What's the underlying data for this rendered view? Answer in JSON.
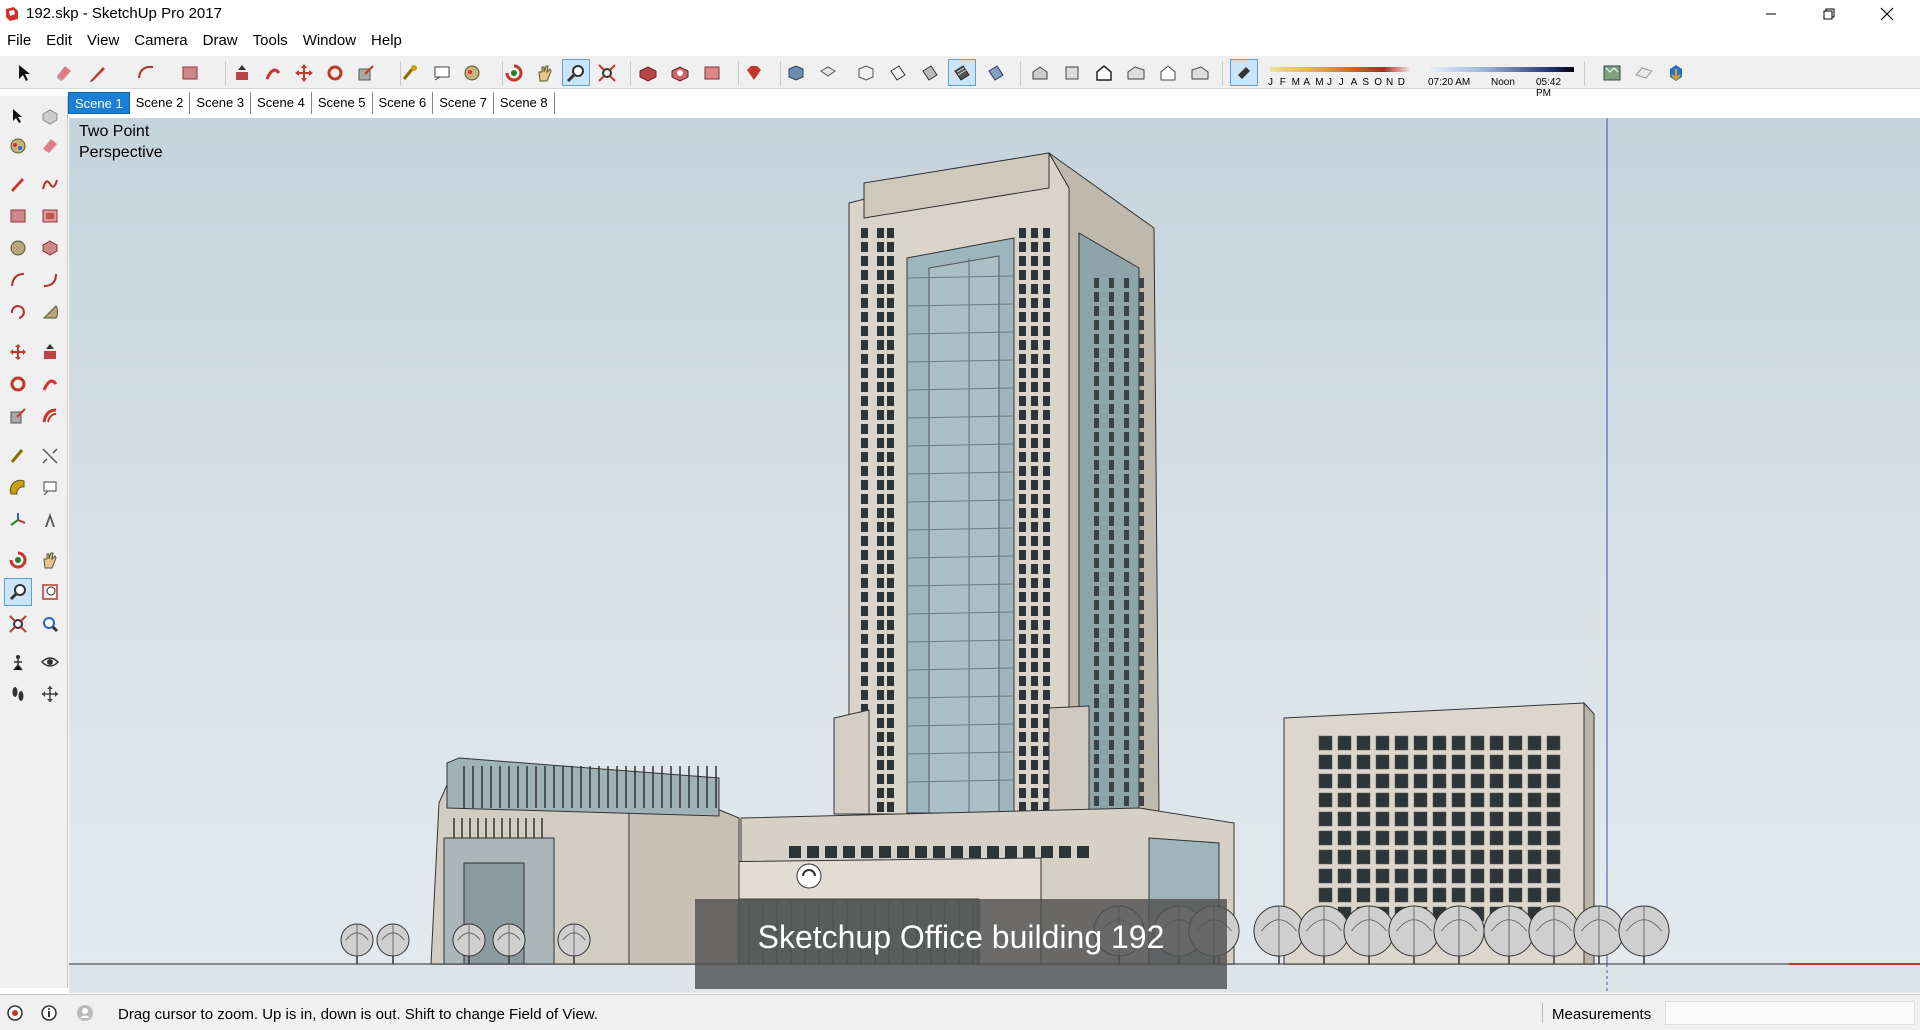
{
  "window": {
    "title": "192.skp - SketchUp Pro 2017",
    "minimize_glyph": "—",
    "maximize_glyph": "❐",
    "close_glyph": "✕"
  },
  "menu": {
    "items": [
      "File",
      "Edit",
      "View",
      "Camera",
      "Draw",
      "Tools",
      "Window",
      "Help"
    ]
  },
  "toolbar": {
    "shadow_months": [
      "J",
      "F",
      "M",
      "A",
      "M",
      "J",
      "J",
      "A",
      "S",
      "O",
      "N",
      "D"
    ],
    "shadow_time_start": "07:20 AM",
    "shadow_time_mid": "Noon",
    "shadow_time_end": "05:42 PM"
  },
  "scenes": {
    "tabs": [
      "Scene 1",
      "Scene 2",
      "Scene 3",
      "Scene 4",
      "Scene 5",
      "Scene 6",
      "Scene 7",
      "Scene 8"
    ],
    "active": "Scene 1"
  },
  "viewport": {
    "camera_label_line1": "Two Point",
    "camera_label_line2": "Perspective",
    "caption": "Sketchup Office building 192"
  },
  "status": {
    "hint": "Drag cursor to zoom.  Up is in, down is out. Shift to change Field of View.",
    "measurements_label": "Measurements",
    "measurements_value": ""
  },
  "colors": {
    "sky": "#cfdbe2",
    "building": "#d8d3c8",
    "glass": "#9fb8c0",
    "active_tab": "#1c7fd6",
    "accent_red": "#c0392b"
  }
}
